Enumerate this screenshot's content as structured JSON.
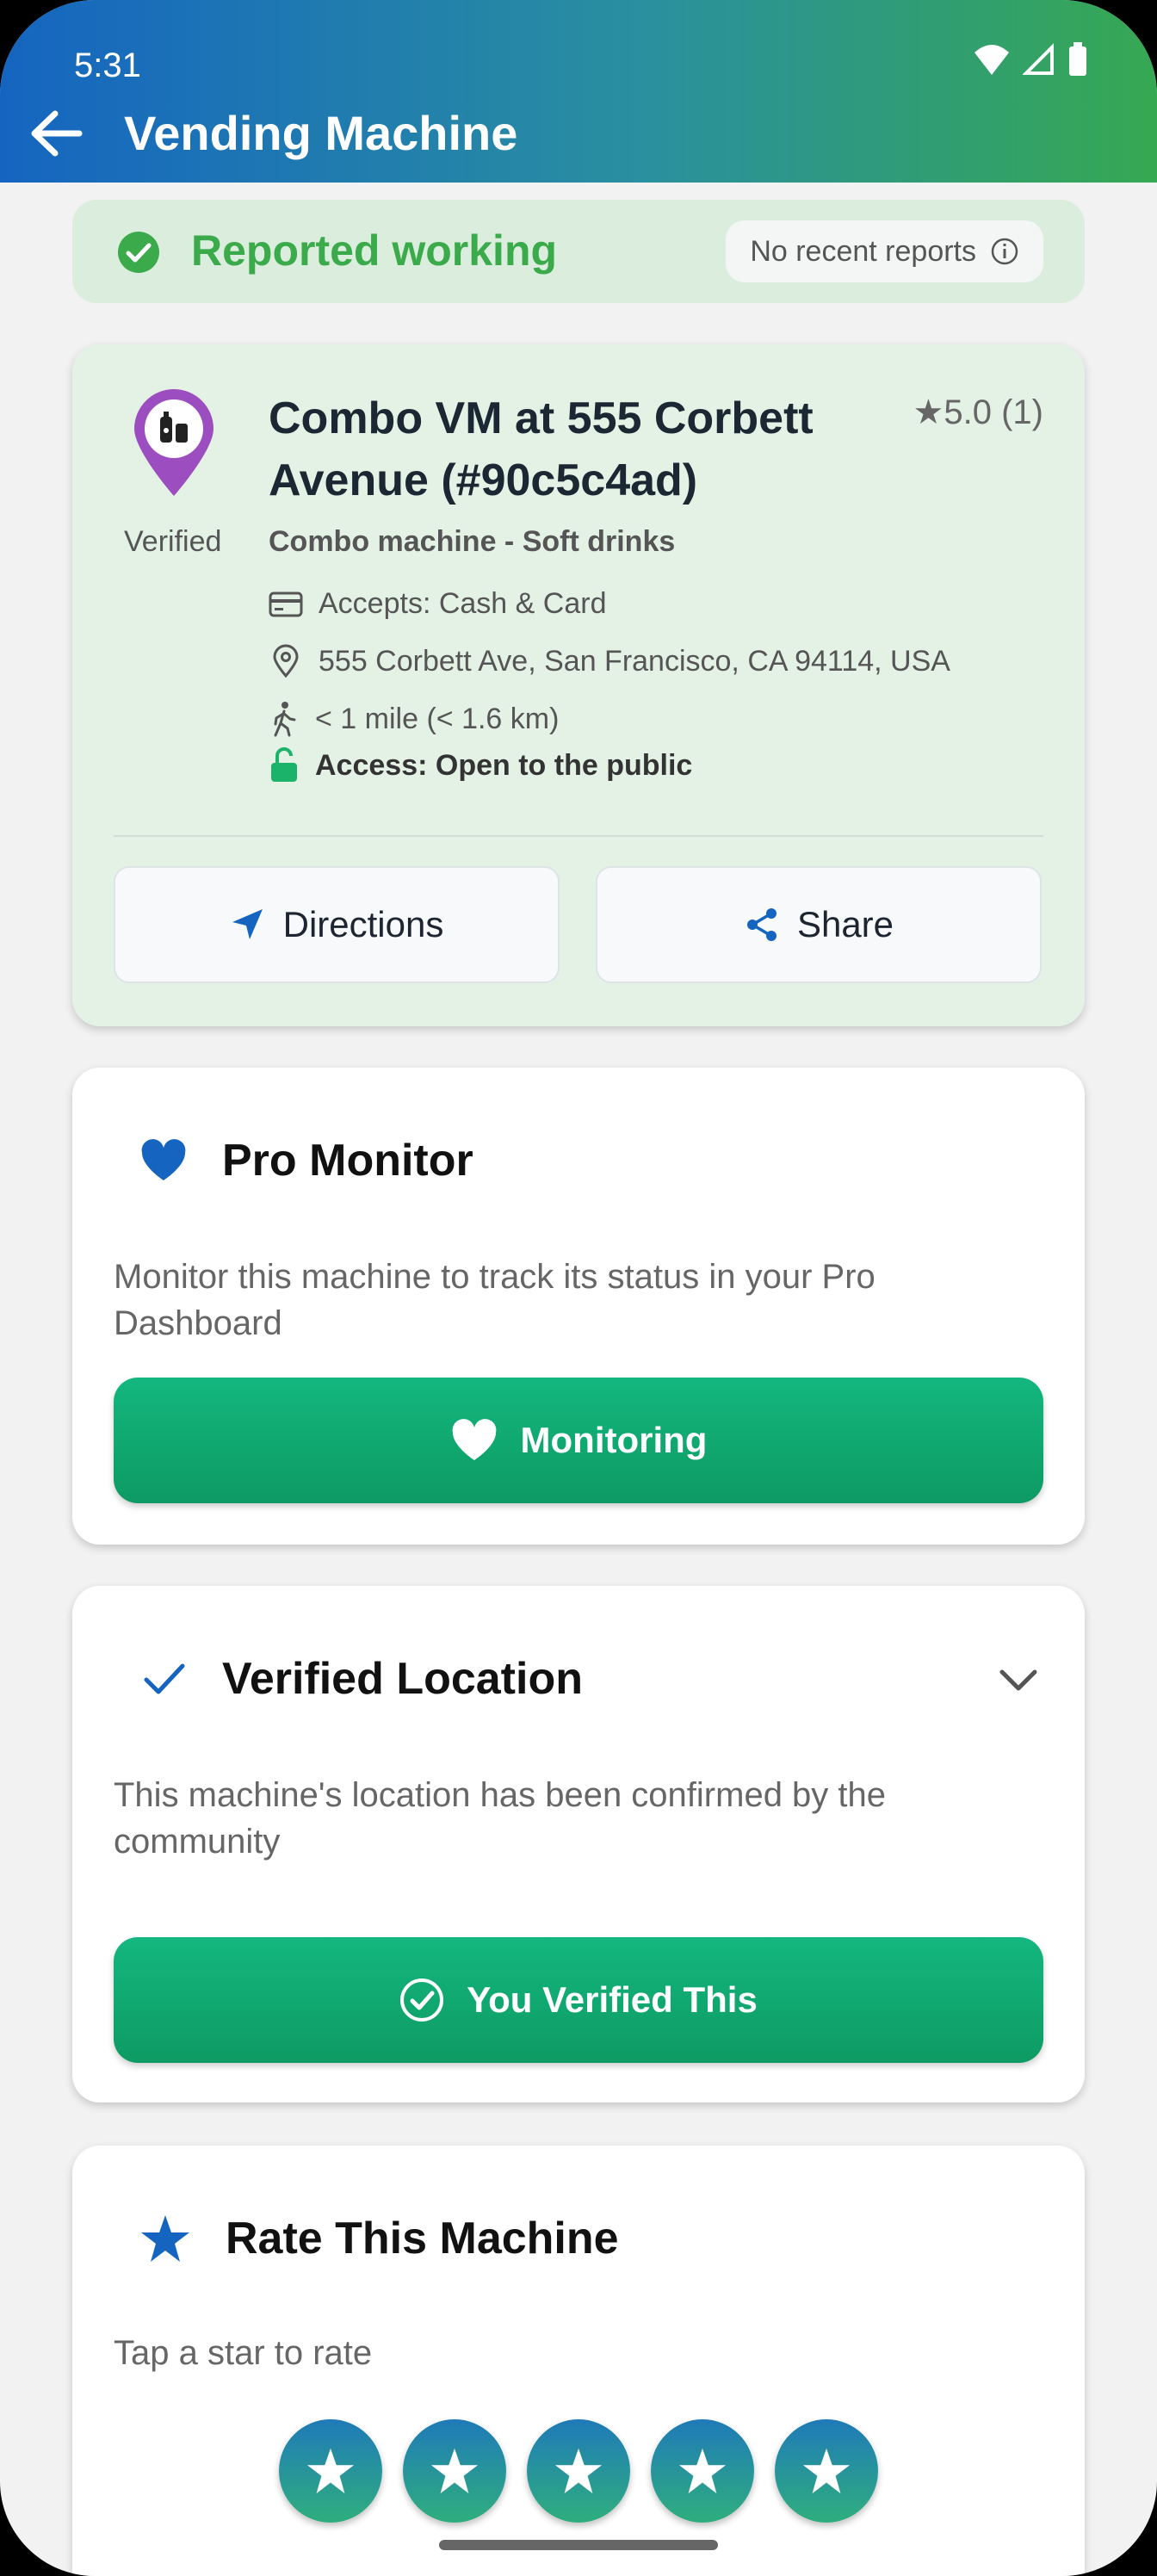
{
  "status_bar": {
    "time": "5:31"
  },
  "appbar": {
    "title": "Vending Machine"
  },
  "banner": {
    "label": "Reported working",
    "chip": "No recent reports"
  },
  "machine": {
    "verified_label": "Verified",
    "title": "Combo VM at 555 Corbett Avenue (#90c5c4ad)",
    "rating": "★5.0 (1)",
    "subtitle": "Combo machine - Soft drinks",
    "accepts": "Accepts: Cash & Card",
    "address": "555 Corbett Ave, San Francisco, CA 94114, USA",
    "distance": "< 1 mile (< 1.6 km)",
    "access": "Access: Open to the public",
    "directions_label": "Directions",
    "share_label": "Share"
  },
  "pro_monitor": {
    "title": "Pro Monitor",
    "description": "Monitor this machine to track its status in your Pro Dashboard",
    "button_label": "Monitoring"
  },
  "verified_location": {
    "title": "Verified Location",
    "description": "This machine's location has been confirmed by the community",
    "button_label": "You Verified This"
  },
  "rate": {
    "title": "Rate This Machine",
    "description": "Tap a star to rate",
    "stars": 5
  },
  "colors": {
    "accent_green": "#0e9a63",
    "accent_blue": "#1565c0",
    "status_green": "#3aaa4a",
    "pin_purple": "#9c4dbf"
  }
}
